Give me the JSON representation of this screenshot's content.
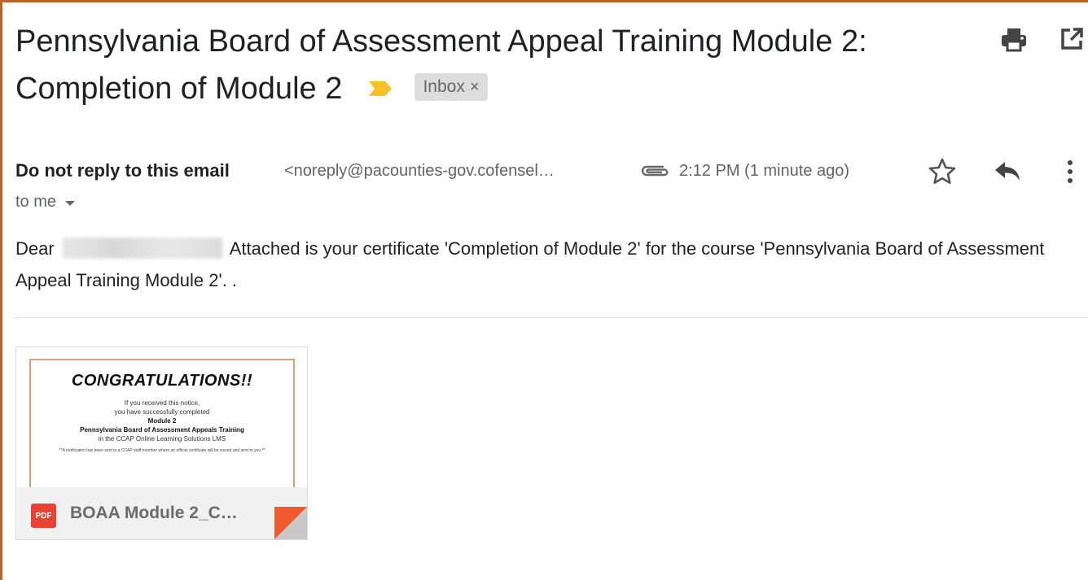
{
  "email": {
    "subject": "Pennsylvania Board of Assessment Appeal Training Module 2: Completion of Module 2",
    "label": "Inbox",
    "label_remove": "×",
    "sender_name": "Do not reply to this email",
    "sender_email": "<noreply@pacounties-gov.cofensel…",
    "time": "2:12 PM (1 minute ago)",
    "recipients": "to me",
    "greeting": "Dear",
    "body": "Attached is your certificate 'Completion of Module 2' for the course 'Pennsylvania Board of Assessment Appeal Training Module 2'. ."
  },
  "attachment": {
    "filename": "BOAA Module 2_C…",
    "file_type": "PDF",
    "preview": {
      "title": "CONGRATULATIONS!!",
      "line1": "If you received this notice,",
      "line2": "you have successfully completed",
      "line3": "Module 2",
      "line4": "Pennsylvania Board of Assessment Appeals Training",
      "line5": "in the CCAP Online Learning Solutions LMS",
      "note": "**A notification has been sent to a CCAP staff member where an official certificate will be issued and sent to you.**"
    }
  },
  "icons": {
    "important": "label-important-icon",
    "print": "print-icon",
    "new_window": "open-in-new-window-icon",
    "attachment": "paperclip-icon",
    "star": "star-icon",
    "reply": "reply-icon",
    "more": "more-vert-icon",
    "caret": "caret-down-icon",
    "pdf": "pdf-icon"
  },
  "colors": {
    "frame": "#b8642e",
    "important": "#f6c026",
    "pdf": "#e94235"
  }
}
